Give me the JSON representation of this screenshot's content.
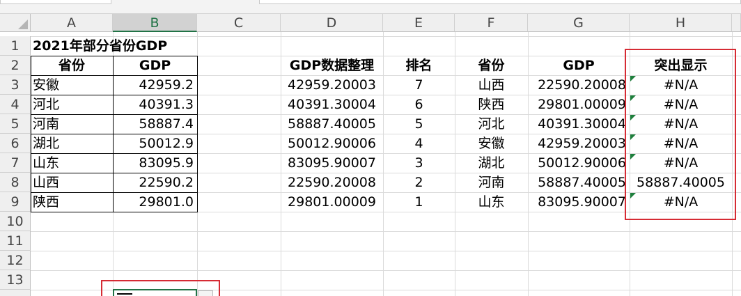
{
  "columns": [
    "A",
    "B",
    "C",
    "D",
    "E",
    "F",
    "G",
    "H"
  ],
  "rows": [
    "1",
    "2",
    "3",
    "4",
    "5",
    "6",
    "7",
    "8",
    "9",
    "10",
    "11",
    "12",
    "13"
  ],
  "title": "2021年部分省份GDP",
  "table1": {
    "headers": [
      "省份",
      "GDP"
    ],
    "rows": [
      [
        "安徽",
        "42959.2"
      ],
      [
        "河北",
        "40391.3"
      ],
      [
        "河南",
        "58887.4"
      ],
      [
        "湖北",
        "50012.9"
      ],
      [
        "山东",
        "83095.9"
      ],
      [
        "山西",
        "22590.2"
      ],
      [
        "陕西",
        "29801.0"
      ]
    ]
  },
  "table2": {
    "headers": [
      "GDP数据整理",
      "排名",
      "省份",
      "GDP",
      "突出显示"
    ],
    "rows": [
      [
        "42959.20003",
        "7",
        "山西",
        "22590.20008",
        "#N/A"
      ],
      [
        "40391.30004",
        "6",
        "陕西",
        "29801.00009",
        "#N/A"
      ],
      [
        "58887.40005",
        "5",
        "河北",
        "40391.30004",
        "#N/A"
      ],
      [
        "50012.90006",
        "4",
        "安徽",
        "42959.20003",
        "#N/A"
      ],
      [
        "83095.90007",
        "3",
        "湖北",
        "50012.90006",
        "#N/A"
      ],
      [
        "22590.20008",
        "2",
        "河南",
        "58887.40005",
        "58887.40005"
      ],
      [
        "29801.00009",
        "1",
        "山东",
        "83095.90007",
        "#N/A"
      ]
    ]
  },
  "colors": {
    "highlight_border": "#d62b34",
    "selected_accent": "#217346",
    "error_triangle": "#1e7f3c"
  }
}
